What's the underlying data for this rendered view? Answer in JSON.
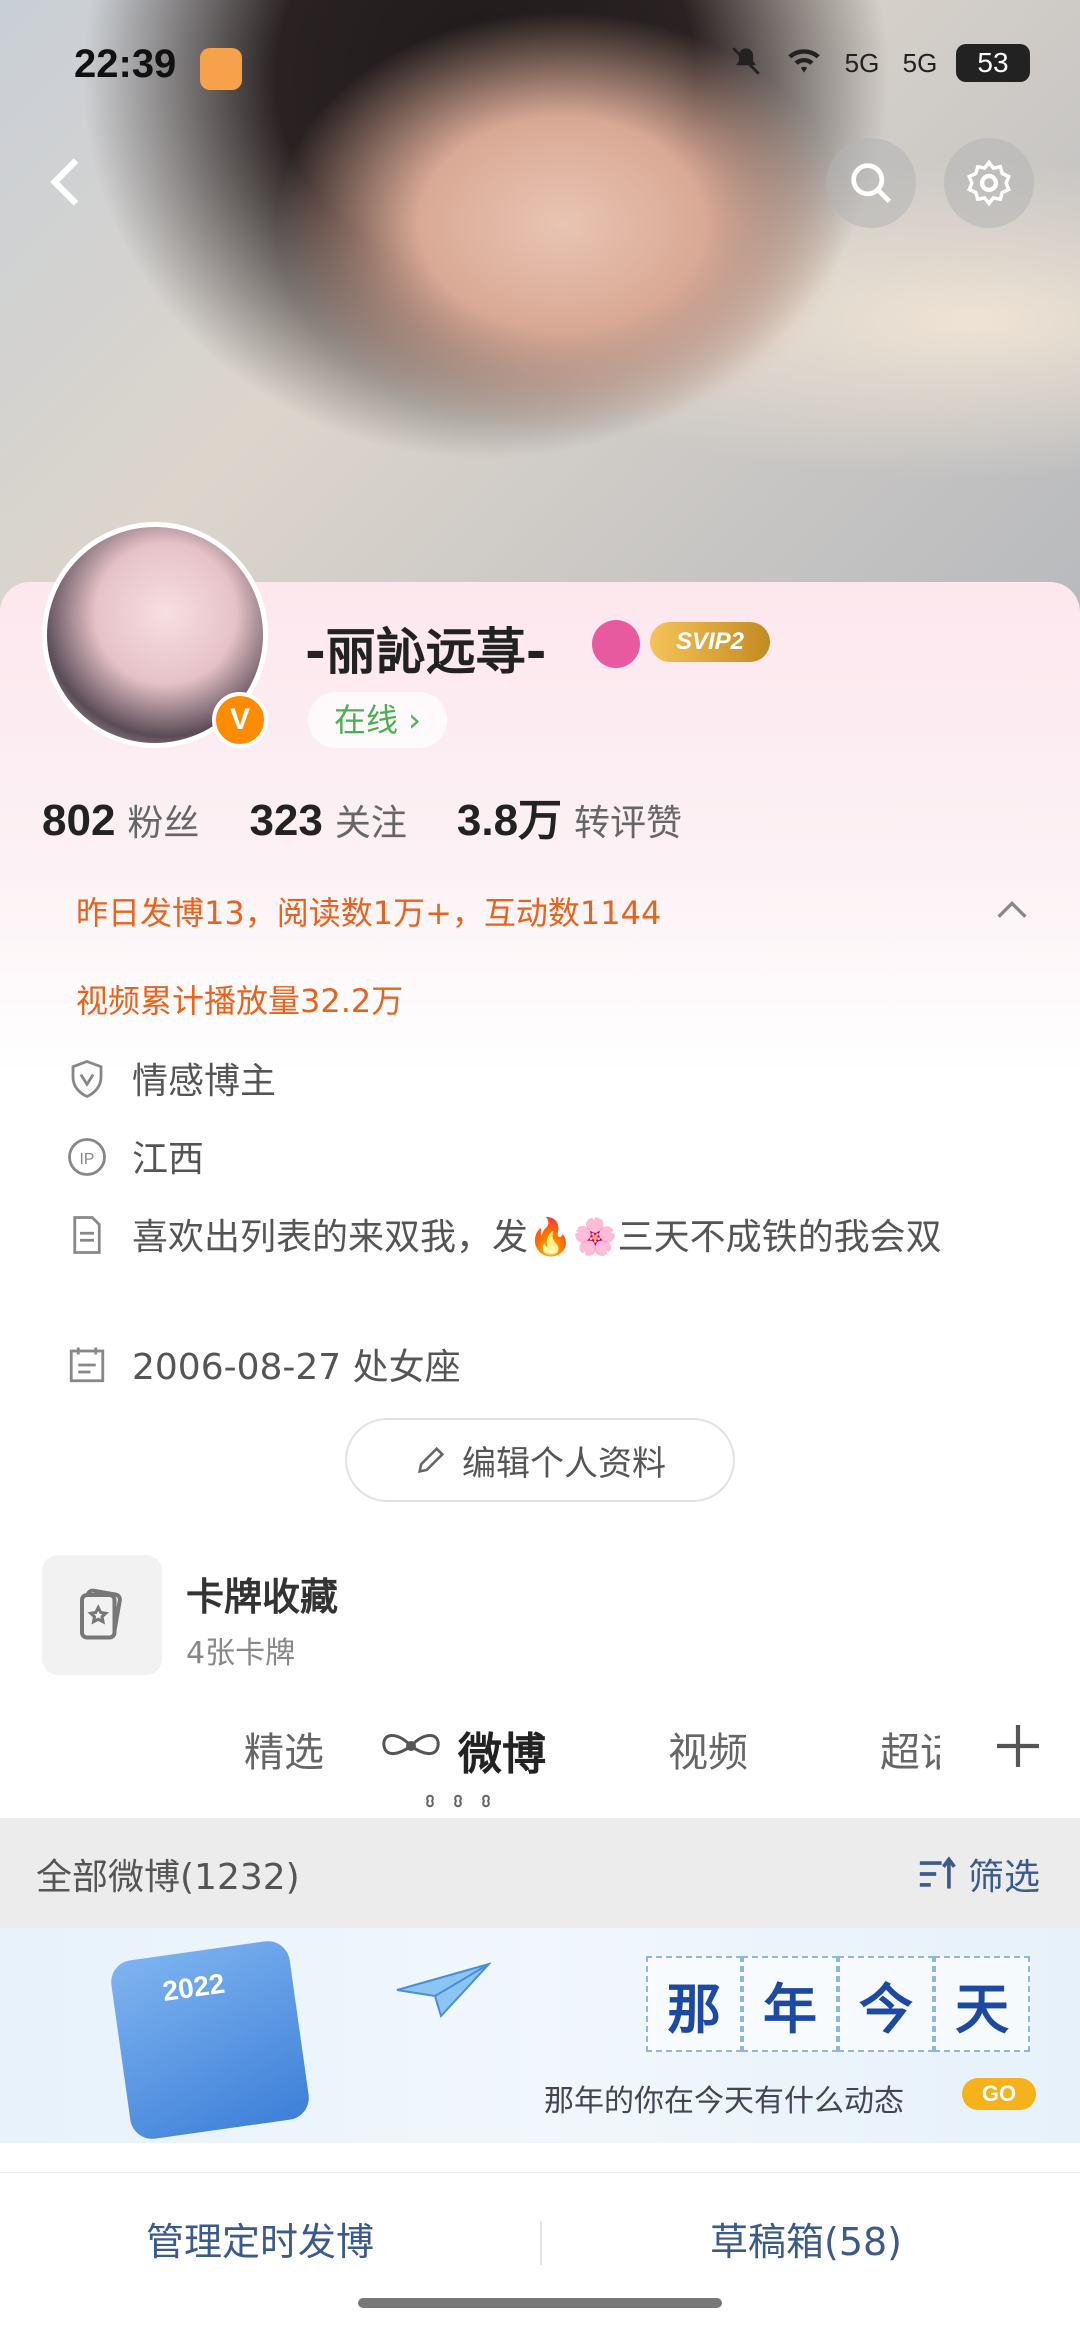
{
  "status_bar": {
    "time": "22:39",
    "network_1": "5G",
    "network_2": "5G",
    "battery": "53"
  },
  "profile": {
    "username": "-丽訫远荨-",
    "svip_label": "SVIP2",
    "online_label": "在线 ›",
    "stats": [
      {
        "value": "802",
        "label": "粉丝"
      },
      {
        "value": "323",
        "label": "关注"
      },
      {
        "value": "3.8万",
        "label": "转评赞"
      }
    ],
    "summary_line_1": "昨日发博13，阅读数1万+，互动数1144",
    "summary_line_2": "视频累计播放量32.2万",
    "info": {
      "tag": "情感博主",
      "location": "江西",
      "bio": "喜欢出列表的来双我，发🔥🌸三天不成铁的我会双",
      "birthday": "2006-08-27 处女座"
    },
    "edit_button": "编辑个人资料",
    "cards": {
      "title": "卡牌收藏",
      "subtitle": "4张卡牌"
    }
  },
  "tabs": [
    "精选",
    "微博",
    "视频",
    "超话"
  ],
  "active_tab": "微博",
  "filter_bar": {
    "left": "全部微博(1232)",
    "right": "筛选"
  },
  "banner": {
    "year": "2022",
    "title_chars": [
      "那",
      "年",
      "今",
      "天"
    ],
    "subtitle": "那年的你在今天有什么动态",
    "go": "GO"
  },
  "bottom_bar": {
    "left": "管理定时发博",
    "right": "草稿箱(58)"
  },
  "colors": {
    "orange": "#e8641e",
    "link_blue": "#3c5a8c",
    "online_green": "#4caf50",
    "svip_gold": "#f5c35a"
  }
}
